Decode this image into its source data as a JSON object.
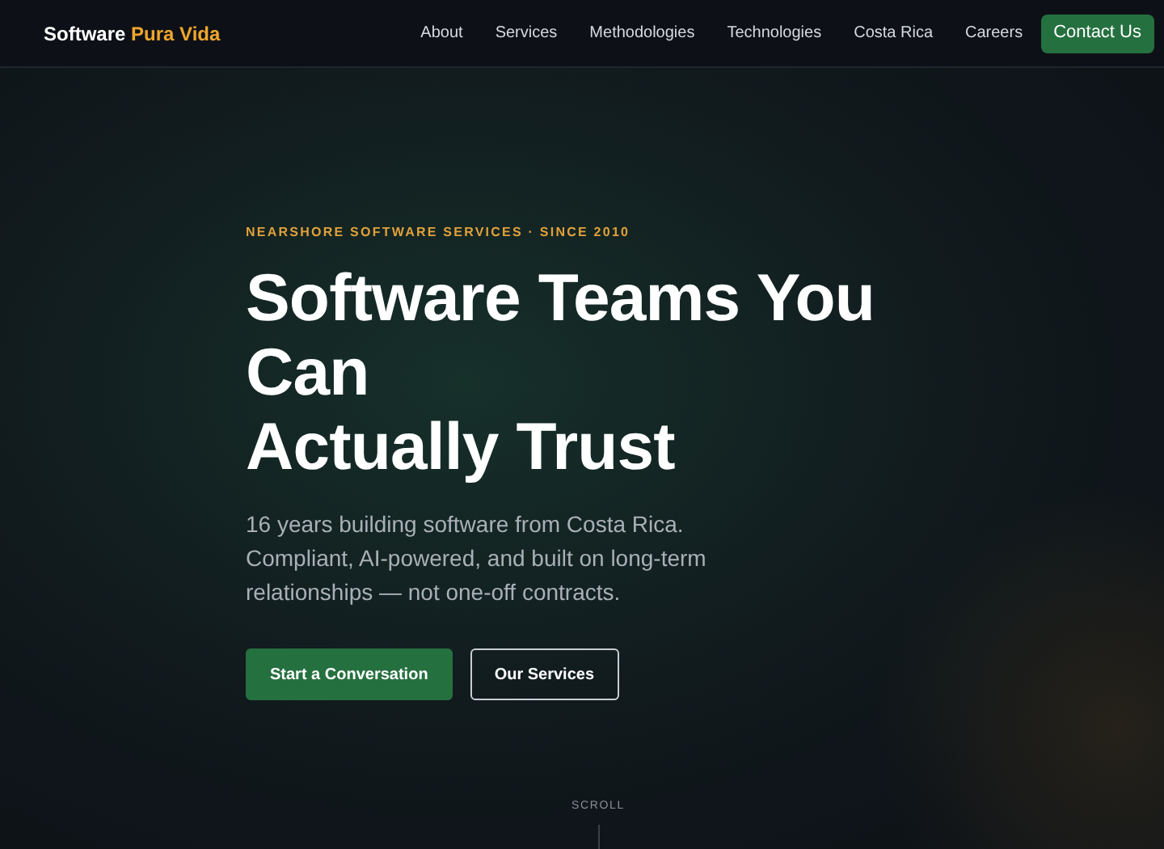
{
  "nav": {
    "logo": {
      "primary": "Software",
      "accent": "Pura Vida"
    },
    "links": [
      "About",
      "Services",
      "Methodologies",
      "Technologies",
      "Costa Rica",
      "Careers"
    ],
    "cta": "Contact Us"
  },
  "hero": {
    "eyebrow": "NEARSHORE SOFTWARE SERVICES · SINCE 2010",
    "headline_lines": [
      "Software Teams You Can",
      "Actually Trust"
    ],
    "subtitle": "16 years building software from Costa Rica. Compliant, AI-powered, and built on long-term relationships — not one-off contracts.",
    "buttons": [
      {
        "label": "Start a Conversation",
        "kind": "primary"
      },
      {
        "label": "Our Services",
        "kind": "outline"
      }
    ],
    "scroll_label": "SCROLL"
  }
}
